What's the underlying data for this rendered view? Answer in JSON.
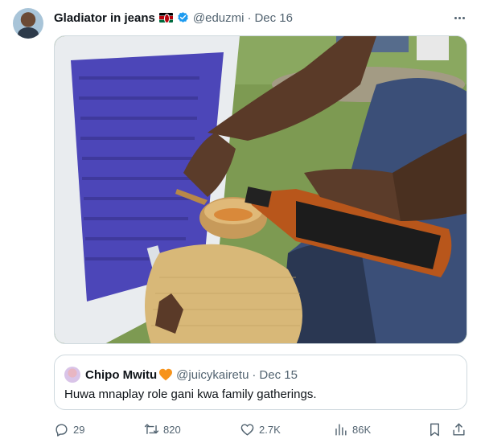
{
  "tweet": {
    "author": {
      "display_name": "Gladiator in jeans",
      "handle": "@eduzmi",
      "date": "Dec 16",
      "separator": "·",
      "verified": true,
      "flag": "kenya-flag"
    },
    "media": {
      "kind": "photo"
    },
    "quoted": {
      "display_name": "Chipo Mwitu",
      "handle": "@juicykairetu",
      "date": "Dec 15",
      "separator": "·",
      "text": "Huwa mnaplay role gani kwa family gatherings."
    },
    "actions": {
      "replies": "29",
      "reposts": "820",
      "likes": "2.7K",
      "views": "86K"
    }
  },
  "colors": {
    "text_primary": "#0f1419",
    "text_secondary": "#536471",
    "verified_blue": "#1d9bf0",
    "heart_orange": "#f7931a",
    "border": "#cfd9de"
  }
}
